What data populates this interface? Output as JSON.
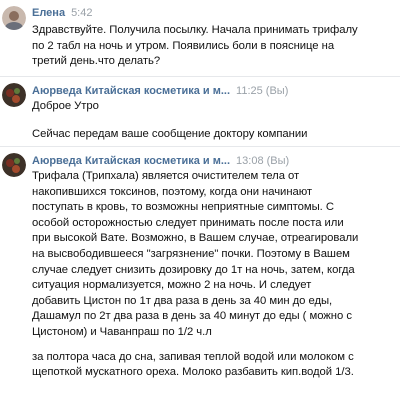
{
  "messages": [
    {
      "author": "Елена",
      "time": "5:42",
      "paragraphs": [
        "Здравствуйте. Получила посылку. Начала принимать трифалу по 2 табл на ночь и утром. Появились боли в пояснице на третий день.что делать?"
      ]
    },
    {
      "author": "Аюрведа Китайская косметика и м...",
      "time": "11:25 (Вы)",
      "paragraphs": [
        "Доброе Утро",
        "Сейчас передам ваше сообщение доктору компании"
      ]
    },
    {
      "author": "Аюрведа Китайская косметика и м...",
      "time": "13:08 (Вы)",
      "paragraphs": [
        "Трифала (Трипхала) является очистителем тела от накопившихся токсинов, поэтому, когда они начинают поступать в кровь, то возможны неприятные симптомы. С особой осторожностью следует принимать после поста или при высокой Вате. Возможно, в Вашем случае, отреагировали на высвободившееся \"загрязнение\" почки. Поэтому в Вашем случае следует снизить дозировку до 1т на ночь, затем, когда ситуация нормализуется, можно 2 на ночь. И следует добавить Цистон по 1т два раза в день за 40 мин до еды, Дашамул по 2т два раза в день за 40 минут до еды ( можно с Цистоном) и Чаванпраш по 1/2 ч.л",
        "за полтора часа до сна, запивая теплой водой или молоком с щепоткой мускатного ореха. Молоко разбавить кип.водой 1/3."
      ]
    }
  ]
}
